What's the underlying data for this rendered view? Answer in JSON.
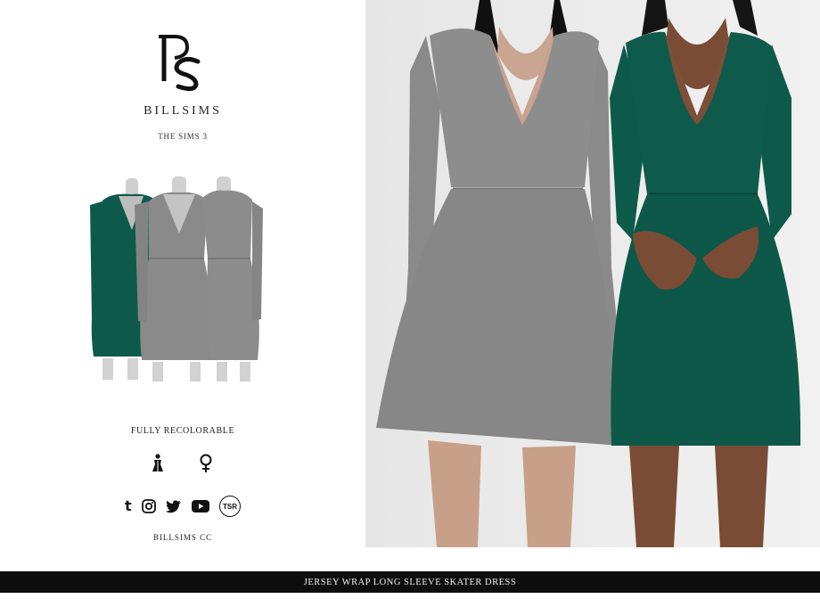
{
  "brand": {
    "name": "BILLSIMS",
    "game": "THE SIMS 3"
  },
  "features": {
    "recolor": "FULLY RECOLORABLE",
    "category_icons": [
      "dress-icon",
      "female-icon"
    ]
  },
  "social": {
    "icons": [
      "tumblr-icon",
      "instagram-icon",
      "twitter-icon",
      "youtube-icon",
      "tsr-icon"
    ],
    "tsr_text": "TSR",
    "tumblr_glyph": "t",
    "credit": "BILLSIMS  CC"
  },
  "product": {
    "title": "JERSEY WRAP LONG SLEEVE SKATER DRESS"
  },
  "colors": {
    "grey_dress": "#8a8a8a",
    "green_dress": "#0e5a4a",
    "footer_bg": "#0d0d0d"
  }
}
